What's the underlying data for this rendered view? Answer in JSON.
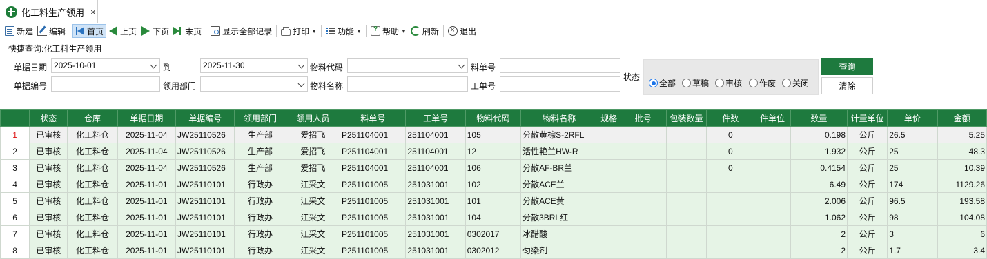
{
  "tab": {
    "title": "化工料生产领用",
    "close": "×"
  },
  "toolbar": {
    "new": "新建",
    "edit": "编辑",
    "first": "首页",
    "prev": "上页",
    "next": "下页",
    "last": "末页",
    "show_all": "显示全部记录",
    "print": "打印",
    "func": "功能",
    "help": "帮助",
    "refresh": "刷新",
    "exit": "退出"
  },
  "query": {
    "title": "快捷查询:化工料生产领用",
    "date_label": "单据日期",
    "date_from": "2025-10-01",
    "to_label": "到",
    "date_to": "2025-11-30",
    "mat_code_label": "物料代码",
    "mat_code": "",
    "order_no_label": "料单号",
    "order_no": "",
    "doc_no_label": "单据编号",
    "doc_no": "",
    "dept_label": "领用部门",
    "dept": "",
    "mat_name_label": "物料名称",
    "mat_name": "",
    "work_no_label": "工单号",
    "work_no": "",
    "status_label": "状态",
    "status_options": [
      "全部",
      "草稿",
      "审核",
      "作废",
      "关闭"
    ],
    "status_selected": "全部",
    "query_btn": "查询",
    "clear_btn": "清除"
  },
  "table": {
    "columns": [
      "",
      "状态",
      "仓库",
      "单据日期",
      "单据编号",
      "领用部门",
      "领用人员",
      "料单号",
      "工单号",
      "物料代码",
      "物料名称",
      "规格",
      "批号",
      "包装数量",
      "件数",
      "件单位",
      "数量",
      "计量单位",
      "单价",
      "金额"
    ],
    "rows": [
      [
        "1",
        "已审核",
        "化工料仓",
        "2025-11-04",
        "JW25110526",
        "生产部",
        "爱招飞",
        "P251104001",
        "251104001",
        "105",
        "分散黄棕S-2RFL",
        "",
        "",
        "",
        "0",
        "",
        "0.198",
        "公斤",
        "26.5",
        "5.25"
      ],
      [
        "2",
        "已审核",
        "化工料仓",
        "2025-11-04",
        "JW25110526",
        "生产部",
        "爱招飞",
        "P251104001",
        "251104001",
        "12",
        "活性艳兰HW-R",
        "",
        "",
        "",
        "0",
        "",
        "1.932",
        "公斤",
        "25",
        "48.3"
      ],
      [
        "3",
        "已审核",
        "化工料仓",
        "2025-11-04",
        "JW25110526",
        "生产部",
        "爱招飞",
        "P251104001",
        "251104001",
        "106",
        "分散AF-BR兰",
        "",
        "",
        "",
        "0",
        "",
        "0.4154",
        "公斤",
        "25",
        "10.39"
      ],
      [
        "4",
        "已审核",
        "化工料仓",
        "2025-11-01",
        "JW25110101",
        "行政办",
        "江采文",
        "P251101005",
        "251031001",
        "102",
        "分散ACE兰",
        "",
        "",
        "",
        "",
        "",
        "6.49",
        "公斤",
        "174",
        "1129.26"
      ],
      [
        "5",
        "已审核",
        "化工料仓",
        "2025-11-01",
        "JW25110101",
        "行政办",
        "江采文",
        "P251101005",
        "251031001",
        "101",
        "分散ACE黄",
        "",
        "",
        "",
        "",
        "",
        "2.006",
        "公斤",
        "96.5",
        "193.58"
      ],
      [
        "6",
        "已审核",
        "化工料仓",
        "2025-11-01",
        "JW25110101",
        "行政办",
        "江采文",
        "P251101005",
        "251031001",
        "104",
        "分散3BRL红",
        "",
        "",
        "",
        "",
        "",
        "1.062",
        "公斤",
        "98",
        "104.08"
      ],
      [
        "7",
        "已审核",
        "化工料仓",
        "2025-11-01",
        "JW25110101",
        "行政办",
        "江采文",
        "P251101005",
        "251031001",
        "0302017",
        "冰醋酸",
        "",
        "",
        "",
        "",
        "",
        "2",
        "公斤",
        "3",
        "6"
      ],
      [
        "8",
        "已审核",
        "化工料仓",
        "2025-11-01",
        "JW25110101",
        "行政办",
        "江采文",
        "P251101005",
        "251031001",
        "0302012",
        "匀染剂",
        "",
        "",
        "",
        "",
        "",
        "2",
        "公斤",
        "1.7",
        "3.4"
      ]
    ]
  },
  "colors": {
    "header_green": "#1e7a3e",
    "row_green": "#e6f4e6",
    "accent_blue": "#1a73e8"
  }
}
